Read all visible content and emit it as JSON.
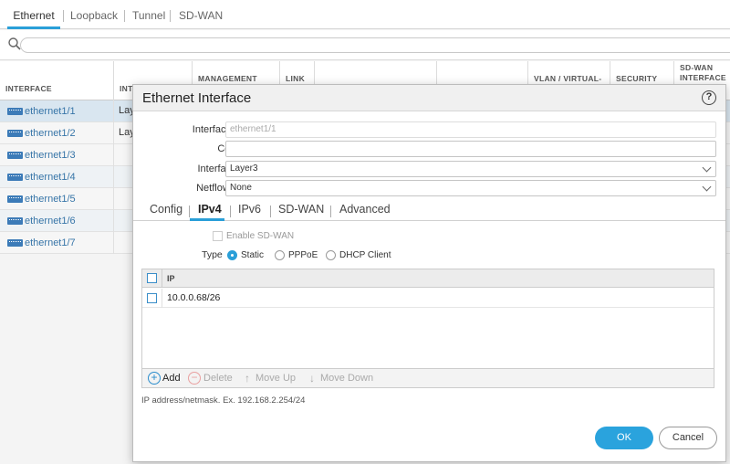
{
  "top_tabs": [
    "Ethernet",
    "Loopback",
    "Tunnel",
    "SD-WAN"
  ],
  "table": {
    "headers": [
      "INTERFACE",
      "INT",
      "MANAGEMENT",
      "LINK",
      "VLAN / VIRTUAL-",
      "SECURITY",
      "SD-WAN",
      "INTERFACE"
    ],
    "rows": [
      {
        "name": "ethernet1/1",
        "type": "Layer"
      },
      {
        "name": "ethernet1/2",
        "type": "Layer"
      },
      {
        "name": "ethernet1/3",
        "type": ""
      },
      {
        "name": "ethernet1/4",
        "type": ""
      },
      {
        "name": "ethernet1/5",
        "type": ""
      },
      {
        "name": "ethernet1/6",
        "type": ""
      },
      {
        "name": "ethernet1/7",
        "type": ""
      }
    ]
  },
  "modal": {
    "title": "Ethernet Interface",
    "help": "?",
    "fields": {
      "interface_name_label": "Interface Name",
      "interface_name_value": "ethernet1/1",
      "comment_label": "Comment",
      "comment_value": "",
      "interface_type_label": "Interface Type",
      "interface_type_value": "Layer3",
      "netflow_label": "Netflow Profile",
      "netflow_value": "None"
    },
    "tabs": [
      "Config",
      "IPv4",
      "IPv6",
      "SD-WAN",
      "Advanced"
    ],
    "active_tab": "IPv4",
    "enable_sdwan_label": "Enable SD-WAN",
    "type_label": "Type",
    "type_options": [
      "Static",
      "PPPoE",
      "DHCP Client"
    ],
    "type_selected": "Static",
    "ip_table": {
      "header": "IP",
      "rows": [
        "10.0.0.68/26"
      ]
    },
    "toolbar": {
      "add": "Add",
      "delete": "Delete",
      "move_up": "Move Up",
      "move_down": "Move Down"
    },
    "hint": "IP address/netmask. Ex. 192.168.2.254/24",
    "ok_label": "OK",
    "cancel_label": "Cancel"
  },
  "colors": {
    "accent": "#2aa3dd",
    "link": "#3775a8",
    "selected_row": "#d9e6f0"
  }
}
